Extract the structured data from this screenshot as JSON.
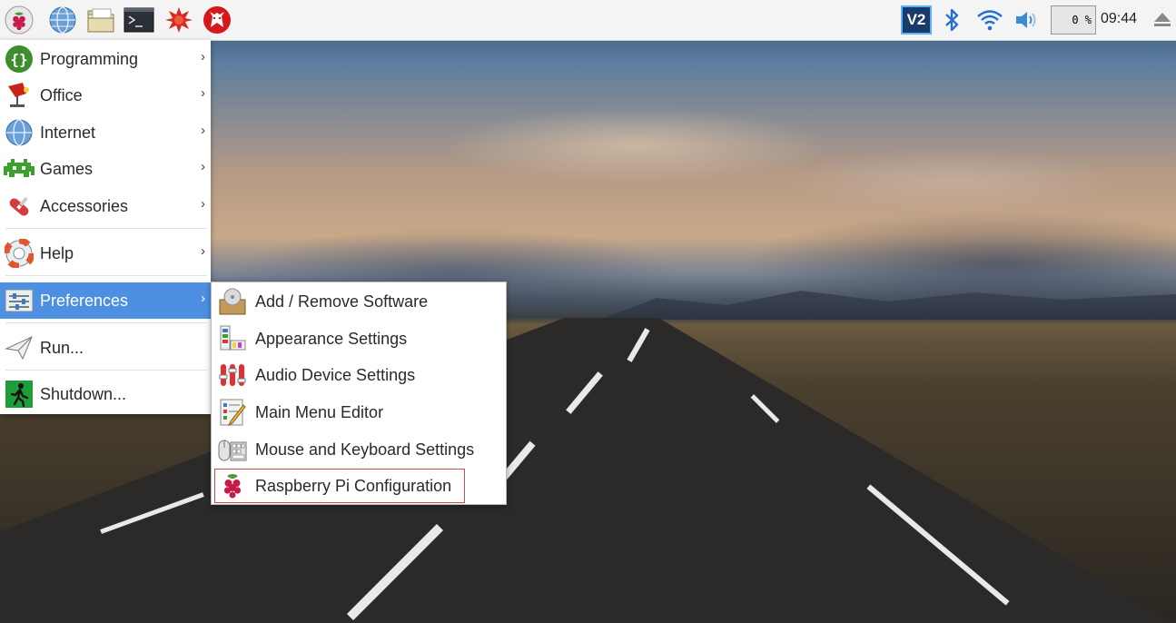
{
  "taskbar": {
    "launchers": [
      {
        "name": "raspberry-menu-icon"
      },
      {
        "name": "web-browser-icon"
      },
      {
        "name": "file-manager-icon"
      },
      {
        "name": "terminal-icon"
      },
      {
        "name": "mathematica-icon"
      },
      {
        "name": "wolfram-icon"
      }
    ],
    "tray": {
      "vnc_label": "V2",
      "cpu_usage": "0 %",
      "clock": "09:44"
    }
  },
  "main_menu": {
    "items": [
      {
        "label": "Programming",
        "has_submenu": true
      },
      {
        "label": "Office",
        "has_submenu": true
      },
      {
        "label": "Internet",
        "has_submenu": true
      },
      {
        "label": "Games",
        "has_submenu": true
      },
      {
        "label": "Accessories",
        "has_submenu": true
      },
      {
        "label": "Help",
        "has_submenu": true
      },
      {
        "label": "Preferences",
        "has_submenu": true,
        "active": true
      },
      {
        "label": "Run...",
        "has_submenu": false
      },
      {
        "label": "Shutdown...",
        "has_submenu": false
      }
    ],
    "arrow": "›"
  },
  "preferences_menu": {
    "items": [
      {
        "label": "Add / Remove Software"
      },
      {
        "label": "Appearance Settings"
      },
      {
        "label": "Audio Device Settings"
      },
      {
        "label": "Main Menu Editor"
      },
      {
        "label": "Mouse and Keyboard Settings"
      },
      {
        "label": "Raspberry Pi Configuration",
        "highlighted": true
      }
    ]
  },
  "colors": {
    "active_menu_bg": "#4d8fe0",
    "highlight_outline": "#d04a4a",
    "taskbar_bg": "#f4f4f4"
  }
}
